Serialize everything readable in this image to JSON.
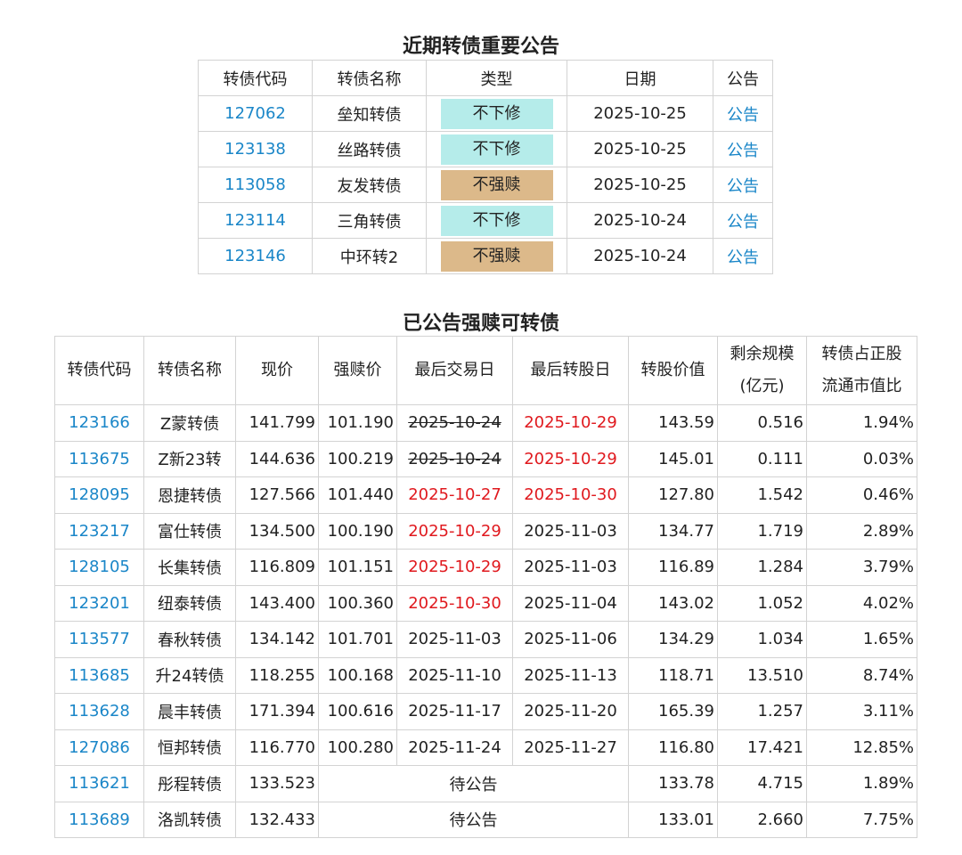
{
  "announcements": {
    "title": "近期转债重要公告",
    "headers": [
      "转债代码",
      "转债名称",
      "类型",
      "日期",
      "公告"
    ],
    "rows": [
      {
        "code": "127062",
        "name": "垒知转债",
        "type": "不下修",
        "date": "2025-10-25",
        "link": "公告"
      },
      {
        "code": "123138",
        "name": "丝路转债",
        "type": "不下修",
        "date": "2025-10-25",
        "link": "公告"
      },
      {
        "code": "113058",
        "name": "友发转债",
        "type": "不强赎",
        "date": "2025-10-25",
        "link": "公告"
      },
      {
        "code": "123114",
        "name": "三角转债",
        "type": "不下修",
        "date": "2025-10-24",
        "link": "公告"
      },
      {
        "code": "123146",
        "name": "中环转2",
        "type": "不强赎",
        "date": "2025-10-24",
        "link": "公告"
      }
    ],
    "type_colors": {
      "不下修": "#b5ecea",
      "不强赎": "#dcb98a"
    }
  },
  "redeem": {
    "title": "已公告强赎可转债",
    "headers": {
      "code": "转债代码",
      "name": "转债名称",
      "price": "现价",
      "redeem_price": "强赎价",
      "last_trade": "最后交易日",
      "last_convert": "最后转股日",
      "convert_value": "转股价值",
      "remaining_line1": "剩余规模",
      "remaining_line2": "(亿元)",
      "ratio_line1": "转债占正股",
      "ratio_line2": "流通市值比"
    },
    "pending_label": "待公告",
    "rows": [
      {
        "code": "123166",
        "name": "Z蒙转债",
        "price": "141.799",
        "redeem_price": "101.190",
        "last_trade": "2025-10-24",
        "last_trade_style": "strike",
        "last_convert": "2025-10-29",
        "last_convert_style": "red",
        "convert_value": "143.59",
        "remaining": "0.516",
        "ratio": "1.94%"
      },
      {
        "code": "113675",
        "name": "Z新23转",
        "price": "144.636",
        "redeem_price": "100.219",
        "last_trade": "2025-10-24",
        "last_trade_style": "strike",
        "last_convert": "2025-10-29",
        "last_convert_style": "red",
        "convert_value": "145.01",
        "remaining": "0.111",
        "ratio": "0.03%"
      },
      {
        "code": "128095",
        "name": "恩捷转债",
        "price": "127.566",
        "redeem_price": "101.440",
        "last_trade": "2025-10-27",
        "last_trade_style": "red",
        "last_convert": "2025-10-30",
        "last_convert_style": "red",
        "convert_value": "127.80",
        "remaining": "1.542",
        "ratio": "0.46%"
      },
      {
        "code": "123217",
        "name": "富仕转债",
        "price": "134.500",
        "redeem_price": "100.190",
        "last_trade": "2025-10-29",
        "last_trade_style": "red",
        "last_convert": "2025-11-03",
        "last_convert_style": "",
        "convert_value": "134.77",
        "remaining": "1.719",
        "ratio": "2.89%"
      },
      {
        "code": "128105",
        "name": "长集转债",
        "price": "116.809",
        "redeem_price": "101.151",
        "last_trade": "2025-10-29",
        "last_trade_style": "red",
        "last_convert": "2025-11-03",
        "last_convert_style": "",
        "convert_value": "116.89",
        "remaining": "1.284",
        "ratio": "3.79%"
      },
      {
        "code": "123201",
        "name": "纽泰转债",
        "price": "143.400",
        "redeem_price": "100.360",
        "last_trade": "2025-10-30",
        "last_trade_style": "red",
        "last_convert": "2025-11-04",
        "last_convert_style": "",
        "convert_value": "143.02",
        "remaining": "1.052",
        "ratio": "4.02%"
      },
      {
        "code": "113577",
        "name": "春秋转债",
        "price": "134.142",
        "redeem_price": "101.701",
        "last_trade": "2025-11-03",
        "last_trade_style": "",
        "last_convert": "2025-11-06",
        "last_convert_style": "",
        "convert_value": "134.29",
        "remaining": "1.034",
        "ratio": "1.65%"
      },
      {
        "code": "113685",
        "name": "升24转债",
        "price": "118.255",
        "redeem_price": "100.168",
        "last_trade": "2025-11-10",
        "last_trade_style": "",
        "last_convert": "2025-11-13",
        "last_convert_style": "",
        "convert_value": "118.71",
        "remaining": "13.510",
        "ratio": "8.74%"
      },
      {
        "code": "113628",
        "name": "晨丰转债",
        "price": "171.394",
        "redeem_price": "100.616",
        "last_trade": "2025-11-17",
        "last_trade_style": "",
        "last_convert": "2025-11-20",
        "last_convert_style": "",
        "convert_value": "165.39",
        "remaining": "1.257",
        "ratio": "3.11%"
      },
      {
        "code": "127086",
        "name": "恒邦转债",
        "price": "116.770",
        "redeem_price": "100.280",
        "last_trade": "2025-11-24",
        "last_trade_style": "",
        "last_convert": "2025-11-27",
        "last_convert_style": "",
        "convert_value": "116.80",
        "remaining": "17.421",
        "ratio": "12.85%"
      },
      {
        "code": "113621",
        "name": "彤程转债",
        "price": "133.523",
        "pending": true,
        "convert_value": "133.78",
        "remaining": "4.715",
        "ratio": "1.89%"
      },
      {
        "code": "113689",
        "name": "洛凯转债",
        "price": "132.433",
        "pending": true,
        "convert_value": "133.01",
        "remaining": "2.660",
        "ratio": "7.75%"
      }
    ]
  }
}
